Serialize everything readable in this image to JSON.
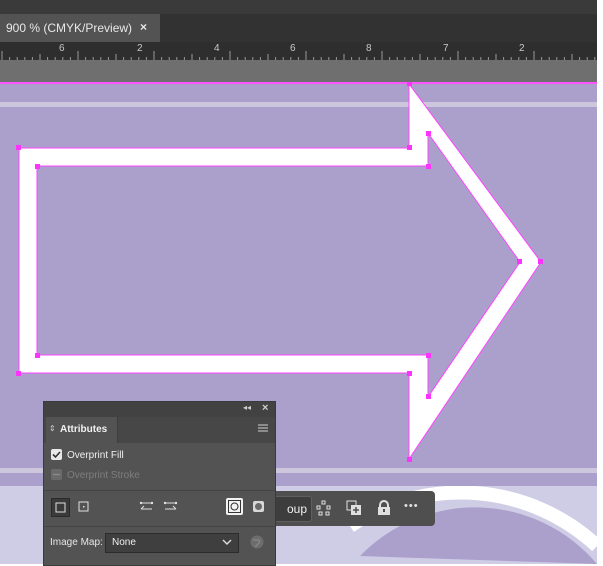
{
  "document_tab": {
    "title": "900 % (CMYK/Preview)",
    "close_glyph": "×"
  },
  "ruler": {
    "numbers": [
      "6",
      "2",
      "4",
      "6",
      "8",
      "7",
      "2"
    ]
  },
  "attributes_panel": {
    "collapse_glyph": "◂◂",
    "close_glyph": "×",
    "tab_label": "Attributes",
    "overprint_fill": {
      "label": "Overprint Fill",
      "checked": true
    },
    "overprint_stroke": {
      "label": "Overprint Stroke",
      "checked": false,
      "enabled": false
    },
    "image_map_label": "Image Map:",
    "image_map_value": "None"
  },
  "context_bar": {
    "group_button_text": "oup",
    "more_glyph": "•••"
  },
  "colors": {
    "artboard_fill": "#ab9fcb",
    "selection_magenta": "#ff33ff",
    "panel_bg": "#535353"
  },
  "icons": [
    "menu-icon",
    "shape-fill-icon",
    "dotted-square-icon",
    "arrange-left-icon",
    "arrange-right-icon",
    "circle-in-square-icon",
    "rounded-square-icon",
    "globe-icon",
    "nodes-icon",
    "duplicate-icon",
    "lock-icon",
    "more-icon"
  ]
}
